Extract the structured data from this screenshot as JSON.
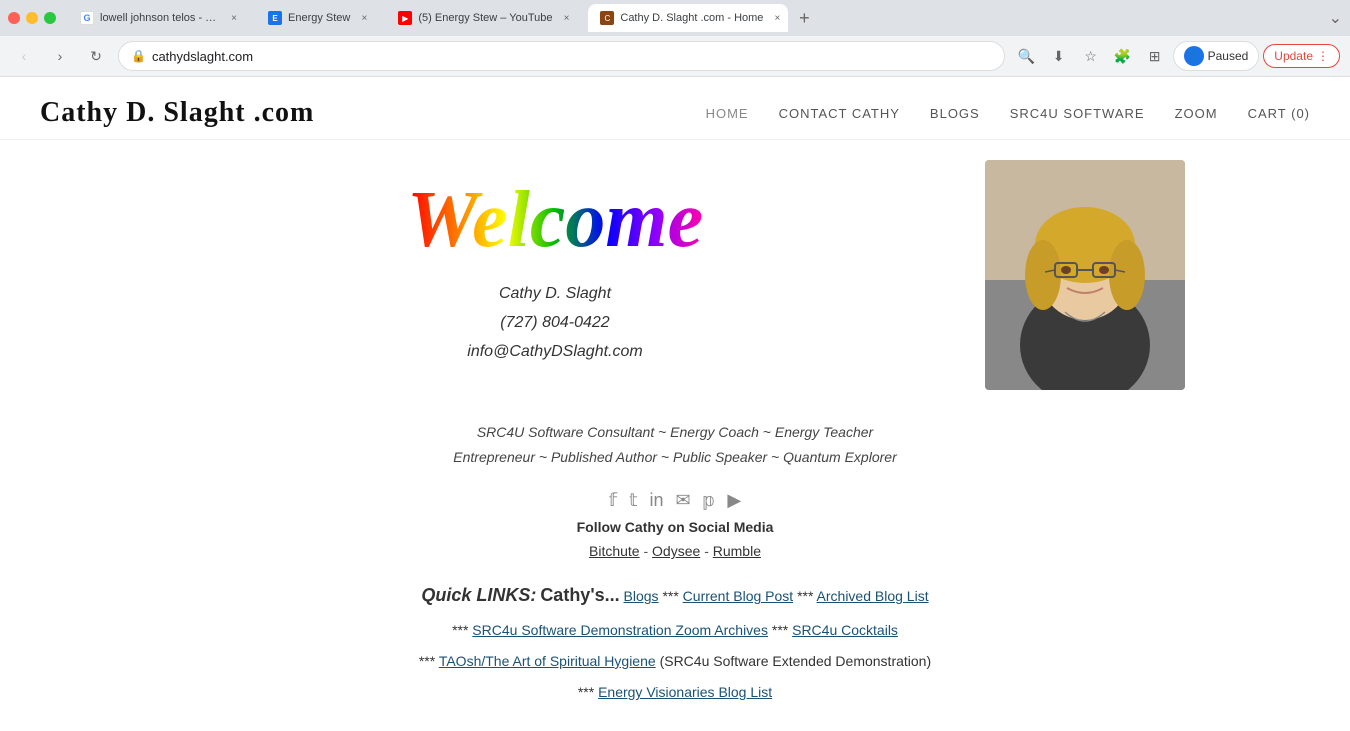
{
  "browser": {
    "tabs": [
      {
        "id": "tab1",
        "title": "lowell johnson telos - Google S...",
        "favicon_type": "g",
        "active": false
      },
      {
        "id": "tab2",
        "title": "Energy Stew",
        "favicon_type": "es",
        "active": false
      },
      {
        "id": "tab3",
        "title": "(5) Energy Stew – YouTube",
        "favicon_type": "yt",
        "active": false
      },
      {
        "id": "tab4",
        "title": "Cathy D. Slaght .com - Home",
        "favicon_type": "cd",
        "active": true
      }
    ],
    "address": "cathydslaght.com",
    "paused_label": "Paused",
    "update_label": "Update"
  },
  "nav": {
    "logo": "Cathy D. Slaght .com",
    "items": [
      {
        "label": "HOME",
        "active": true
      },
      {
        "label": "CONTACT CATHY",
        "active": false
      },
      {
        "label": "BLOGS",
        "active": false
      },
      {
        "label": "SRC4U SOFTWARE",
        "active": false
      },
      {
        "label": "ZOOM",
        "active": false
      },
      {
        "label": "CART (0)",
        "active": false
      }
    ]
  },
  "hero": {
    "welcome_text": "Welcome",
    "name": "Cathy D. Slaght",
    "phone": "(727) 804-0422",
    "email": "info@CathyDSlaght.com"
  },
  "tagline": {
    "line1": "SRC4U Software Consultant ~ Energy Coach ~ Energy Teacher",
    "line2": "Entrepreneur ~ Published Author ~ Public Speaker ~ Quantum Explorer"
  },
  "social": {
    "follow_label": "Follow Cathy on Social Media",
    "video_links": {
      "bitchute": "Bitchute",
      "odysee": "Odysee",
      "rumble": "Rumble",
      "separator": " - "
    }
  },
  "quick_links": {
    "title": "Quick LINKS:",
    "cathys": "Cathy's...",
    "line1_pre": "",
    "blogs_label": "Blogs",
    "separator1": " *** ",
    "current_blog_label": "Current Blog Post",
    "separator2": " *** ",
    "archived_blog_label": "Archived Blog List",
    "line2_pre": "*** ",
    "src4u_demo_label": "SRC4u Software Demonstration Zoom Archives",
    "separator3": " *** ",
    "src4u_cocktails_label": "SRC4u Cocktails",
    "line3_pre": "*** ",
    "taosh_label": "TAOsh/The Art of Spiritual Hygiene",
    "taosh_desc": " (SRC4u Software Extended Demonstration)",
    "line4_pre": "*** ",
    "energy_visionaries_label": "Energy Visionaries Blog List"
  }
}
